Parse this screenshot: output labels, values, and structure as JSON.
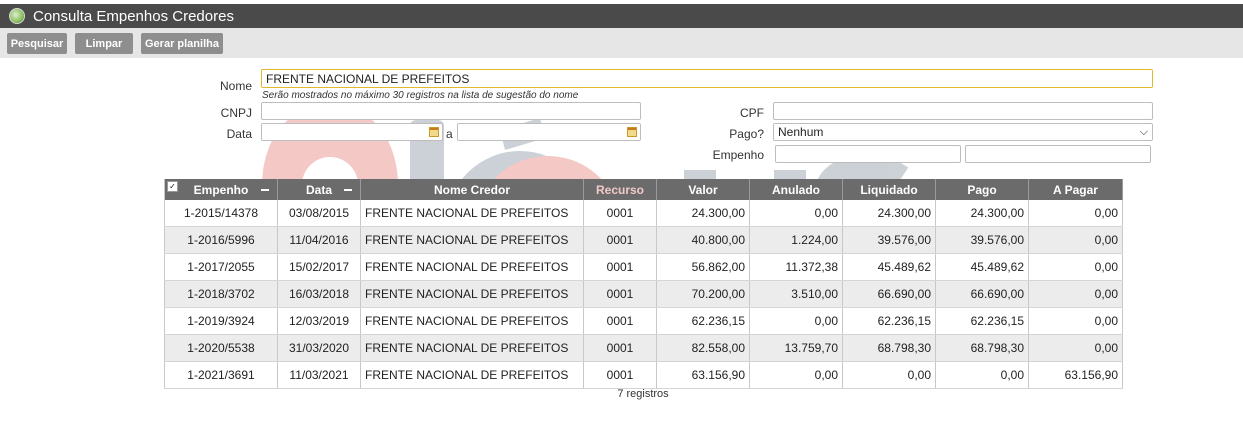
{
  "window": {
    "title": "Consulta Empenhos Credores",
    "icon": "app-globe-icon"
  },
  "toolbar": {
    "search_label": "Pesquisar",
    "clear_label": "Limpar",
    "export_label": "Gerar planilha"
  },
  "form": {
    "nome_label": "Nome",
    "nome_value": "FRENTE NACIONAL DE PREFEITOS",
    "nome_hint": "Serão mostrados no máximo 30 registros na lista de sugestão do nome",
    "cnpj_label": "CNPJ",
    "cnpj_value": "",
    "cpf_label": "CPF",
    "cpf_value": "",
    "data_label": "Data",
    "data_from": "",
    "data_sep": "a",
    "data_to": "",
    "pago_label": "Pago?",
    "pago_value": "Nenhum",
    "empenho_label": "Empenho",
    "empenho_from": "",
    "empenho_to": ""
  },
  "watermark": {
    "text": "lócus",
    "colors": [
      "#e05a4f",
      "#5f7381"
    ]
  },
  "table": {
    "headers": [
      "Empenho",
      "Data",
      "Nome Credor",
      "Recurso",
      "Valor",
      "Anulado",
      "Liquidado",
      "Pago",
      "A Pagar"
    ],
    "rows": [
      [
        "1-2015/14378",
        "03/08/2015",
        "FRENTE NACIONAL DE PREFEITOS",
        "0001",
        "24.300,00",
        "0,00",
        "24.300,00",
        "24.300,00",
        "0,00"
      ],
      [
        "1-2016/5996",
        "11/04/2016",
        "FRENTE NACIONAL DE PREFEITOS",
        "0001",
        "40.800,00",
        "1.224,00",
        "39.576,00",
        "39.576,00",
        "0,00"
      ],
      [
        "1-2017/2055",
        "15/02/2017",
        "FRENTE NACIONAL DE PREFEITOS",
        "0001",
        "56.862,00",
        "11.372,38",
        "45.489,62",
        "45.489,62",
        "0,00"
      ],
      [
        "1-2018/3702",
        "16/03/2018",
        "FRENTE NACIONAL DE PREFEITOS",
        "0001",
        "70.200,00",
        "3.510,00",
        "66.690,00",
        "66.690,00",
        "0,00"
      ],
      [
        "1-2019/3924",
        "12/03/2019",
        "FRENTE NACIONAL DE PREFEITOS",
        "0001",
        "62.236,15",
        "0,00",
        "62.236,15",
        "62.236,15",
        "0,00"
      ],
      [
        "1-2020/5538",
        "31/03/2020",
        "FRENTE NACIONAL DE PREFEITOS",
        "0001",
        "82.558,00",
        "13.759,70",
        "68.798,30",
        "68.798,30",
        "0,00"
      ],
      [
        "1-2021/3691",
        "11/03/2021",
        "FRENTE NACIONAL DE PREFEITOS",
        "0001",
        "63.156,90",
        "0,00",
        "0,00",
        "0,00",
        "63.156,90"
      ]
    ],
    "count_label": "7 registros"
  }
}
